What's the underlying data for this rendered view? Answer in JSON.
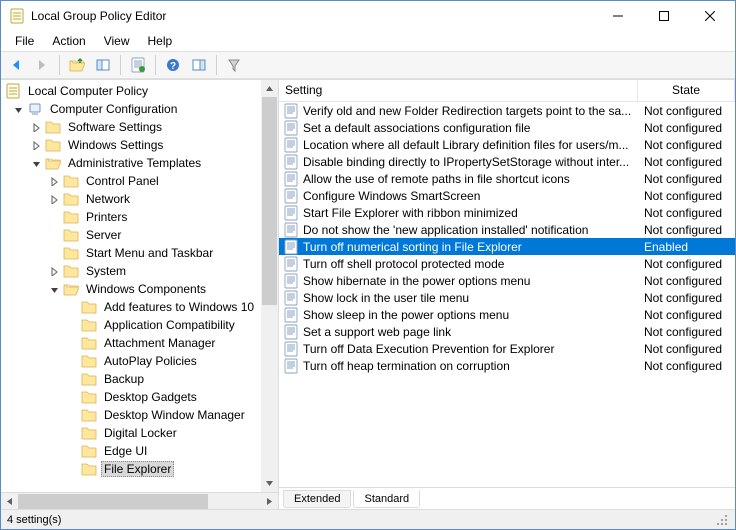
{
  "window": {
    "title": "Local Group Policy Editor"
  },
  "sysmenu": {
    "minimize": "Minimize",
    "maximize": "Maximize",
    "close": "Close"
  },
  "menu": {
    "file": "File",
    "action": "Action",
    "view": "View",
    "help": "Help"
  },
  "toolbar": {
    "back": "Back",
    "forward": "Forward",
    "up": "Up one level",
    "show_hide_tree": "Show/Hide Console Tree",
    "properties": "Properties",
    "help": "Help",
    "show_hide_action": "Show/Hide Action Pane",
    "filter": "Filter"
  },
  "tree": {
    "root": "Local Computer Policy",
    "cc": "Computer Configuration",
    "ss": "Software Settings",
    "ws": "Windows Settings",
    "at": "Administrative Templates",
    "cp": "Control Panel",
    "net": "Network",
    "prn": "Printers",
    "srv": "Server",
    "smt": "Start Menu and Taskbar",
    "sys": "System",
    "wc": "Windows Components",
    "wc_items": [
      "Add features to Windows 10",
      "Application Compatibility",
      "Attachment Manager",
      "AutoPlay Policies",
      "Backup",
      "Desktop Gadgets",
      "Desktop Window Manager",
      "Digital Locker",
      "Edge UI",
      "File Explorer"
    ]
  },
  "list": {
    "col_setting": "Setting",
    "col_state": "State",
    "selected_index": 8,
    "rows": [
      {
        "setting": "Verify old and new Folder Redirection targets point to the sa...",
        "state": "Not configured"
      },
      {
        "setting": "Set a default associations configuration file",
        "state": "Not configured"
      },
      {
        "setting": "Location where all default Library definition files for users/m...",
        "state": "Not configured"
      },
      {
        "setting": "Disable binding directly to IPropertySetStorage without inter...",
        "state": "Not configured"
      },
      {
        "setting": "Allow the use of remote paths in file shortcut icons",
        "state": "Not configured"
      },
      {
        "setting": "Configure Windows SmartScreen",
        "state": "Not configured"
      },
      {
        "setting": "Start File Explorer with ribbon minimized",
        "state": "Not configured"
      },
      {
        "setting": "Do not show the 'new application installed' notification",
        "state": "Not configured"
      },
      {
        "setting": "Turn off numerical sorting in File Explorer",
        "state": "Enabled"
      },
      {
        "setting": "Turn off shell protocol protected mode",
        "state": "Not configured"
      },
      {
        "setting": "Show hibernate in the power options menu",
        "state": "Not configured"
      },
      {
        "setting": "Show lock in the user tile menu",
        "state": "Not configured"
      },
      {
        "setting": "Show sleep in the power options menu",
        "state": "Not configured"
      },
      {
        "setting": "Set a support web page link",
        "state": "Not configured"
      },
      {
        "setting": "Turn off Data Execution Prevention for Explorer",
        "state": "Not configured"
      },
      {
        "setting": "Turn off heap termination on corruption",
        "state": "Not configured"
      }
    ]
  },
  "tabs": {
    "extended": "Extended",
    "standard": "Standard"
  },
  "status": {
    "text": "4 setting(s)"
  }
}
